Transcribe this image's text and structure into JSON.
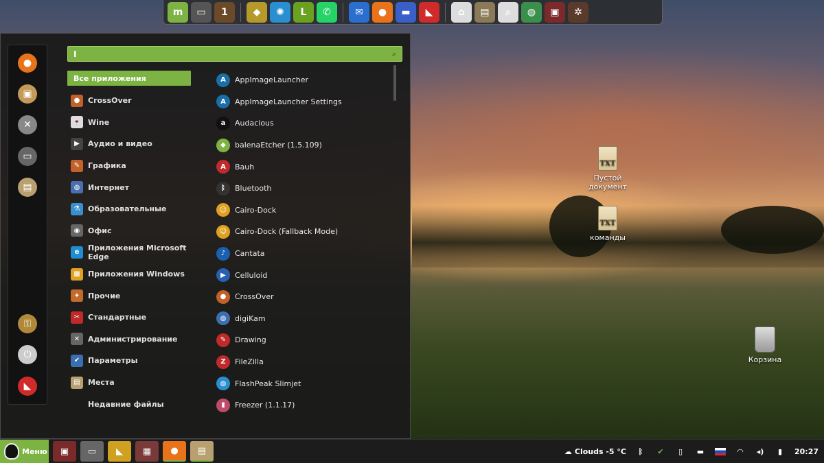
{
  "dock": {
    "items": [
      {
        "name": "linux-mint-icon",
        "glyph": "m",
        "color": "#7cb342"
      },
      {
        "name": "terminal-icon",
        "glyph": "▭",
        "color": "#555"
      },
      {
        "name": "workspace-icon",
        "glyph": "1",
        "color": "#6b4a2a"
      },
      {
        "name": "gpu-viewer-icon",
        "glyph": "◆",
        "color": "#b59a2a"
      },
      {
        "name": "blender-icon",
        "glyph": "✺",
        "color": "#2a8fd0"
      },
      {
        "name": "lime-icon",
        "glyph": "L",
        "color": "#6aa121"
      },
      {
        "name": "whatsapp-icon",
        "glyph": "✆",
        "color": "#25d366"
      },
      {
        "name": "thunderbird-icon",
        "glyph": "✉",
        "color": "#2a6fd0"
      },
      {
        "name": "firefox-icon",
        "glyph": "●",
        "color": "#e8731b"
      },
      {
        "name": "folder-icon",
        "glyph": "▬",
        "color": "#3a5fc8"
      },
      {
        "name": "pdf-reader-icon",
        "glyph": "◣",
        "color": "#d02a2a"
      },
      {
        "name": "home-icon",
        "glyph": "⌂",
        "color": "#ddd"
      },
      {
        "name": "scroll-icon",
        "glyph": "▤",
        "color": "#8a7a55"
      },
      {
        "name": "search-tool-icon",
        "glyph": "⌕",
        "color": "#ddd"
      },
      {
        "name": "globe-icon",
        "glyph": "◍",
        "color": "#3a8f4a"
      },
      {
        "name": "display-icon",
        "glyph": "▣",
        "color": "#7a2a2a"
      },
      {
        "name": "cannon-icon",
        "glyph": "✲",
        "color": "#5a3a2a"
      }
    ]
  },
  "desktop": {
    "icons": [
      {
        "label": "Пустой документ",
        "badge": "TXT"
      },
      {
        "label": "команды",
        "badge": "TXT"
      },
      {
        "label": "Корзина"
      }
    ]
  },
  "menu": {
    "search": {
      "value": "I"
    },
    "side_items": [
      {
        "name": "firefox-side-icon",
        "glyph": "●",
        "color": "#e8731b"
      },
      {
        "name": "package-side-icon",
        "glyph": "▣",
        "color": "#c49a5a"
      },
      {
        "name": "tools-side-icon",
        "glyph": "✕",
        "color": "#888"
      },
      {
        "name": "terminal-side-icon",
        "glyph": "▭",
        "color": "#666"
      },
      {
        "name": "files-side-icon",
        "glyph": "▤",
        "color": "#b8a070"
      },
      {
        "name": "lock-side-icon",
        "glyph": "⚿",
        "color": "#b08a3a"
      },
      {
        "name": "logout-side-icon",
        "glyph": "⏻",
        "color": "#ccc"
      },
      {
        "name": "shutdown-side-icon",
        "glyph": "◣",
        "color": "#d02a2a"
      }
    ],
    "categories": [
      {
        "label": "Все приложения",
        "glyph": ""
      },
      {
        "label": "CrossOver",
        "glyph": "●",
        "color": "#c0612a"
      },
      {
        "label": "Wine",
        "glyph": "🍷",
        "color": "#ddd"
      },
      {
        "label": "Аудио и видео",
        "glyph": "▶",
        "color": "#444"
      },
      {
        "label": "Графика",
        "glyph": "✎",
        "color": "#c4602a"
      },
      {
        "label": "Интернет",
        "glyph": "◍",
        "color": "#4a6fb0"
      },
      {
        "label": "Образовательные",
        "glyph": "⚗",
        "color": "#3a8fd0"
      },
      {
        "label": "Офис",
        "glyph": "◉",
        "color": "#666"
      },
      {
        "label": "Приложения Microsoft Edge",
        "glyph": "e",
        "color": "#1e8ed0"
      },
      {
        "label": "Приложения Windows",
        "glyph": "▦",
        "color": "#e0a020"
      },
      {
        "label": "Прочие",
        "glyph": "✦",
        "color": "#c46a2a"
      },
      {
        "label": "Стандартные",
        "glyph": "✂",
        "color": "#c02a2a"
      },
      {
        "label": "Администрирование",
        "glyph": "✕",
        "color": "#666"
      },
      {
        "label": "Параметры",
        "glyph": "✔",
        "color": "#3a6fb0"
      },
      {
        "label": "Места",
        "glyph": "▤",
        "color": "#b8a070"
      },
      {
        "label": "Недавние файлы",
        "glyph": ""
      }
    ],
    "apps": [
      {
        "label": "AppImageLauncher",
        "glyph": "A",
        "color": "#1a6fa8"
      },
      {
        "label": "AppImageLauncher Settings",
        "glyph": "A",
        "color": "#1a6fa8"
      },
      {
        "label": "Audacious",
        "glyph": "a",
        "color": "#111"
      },
      {
        "label": "balenaEtcher (1.5.109)",
        "glyph": "◆",
        "color": "#7cb342"
      },
      {
        "label": "Bauh",
        "glyph": "A",
        "color": "#c02a2a"
      },
      {
        "label": "Bluetooth",
        "glyph": "ᛒ",
        "color": "#333"
      },
      {
        "label": "Cairo-Dock",
        "glyph": "☺",
        "color": "#e0a020"
      },
      {
        "label": "Cairo-Dock (Fallback Mode)",
        "glyph": "☺",
        "color": "#e0a020"
      },
      {
        "label": "Cantata",
        "glyph": "♪",
        "color": "#1a5fb0"
      },
      {
        "label": "Celluloid",
        "glyph": "▶",
        "color": "#2a5fb0"
      },
      {
        "label": "CrossOver",
        "glyph": "●",
        "color": "#c0612a"
      },
      {
        "label": "digiKam",
        "glyph": "◍",
        "color": "#3a6fb0"
      },
      {
        "label": "Drawing",
        "glyph": "✎",
        "color": "#c02a2a"
      },
      {
        "label": "FileZilla",
        "glyph": "Z",
        "color": "#c02a2a"
      },
      {
        "label": "FlashPeak Slimjet",
        "glyph": "◍",
        "color": "#2a8fd0"
      },
      {
        "label": "Freezer (1.1.17)",
        "glyph": "▮",
        "color": "#c04a6a"
      }
    ]
  },
  "panel": {
    "menu_label": "Меню",
    "tasks": [
      {
        "name": "display-task-icon",
        "glyph": "▣",
        "color": "#7a2a2a",
        "active": false
      },
      {
        "name": "terminal-task-icon",
        "glyph": "▭",
        "color": "#666",
        "active": false
      },
      {
        "name": "colorful-app-task-icon",
        "glyph": "◣",
        "color": "#d0a020",
        "active": false
      },
      {
        "name": "grid-app-task-icon",
        "glyph": "▦",
        "color": "#7a3a3a",
        "active": false
      },
      {
        "name": "firefox-task-icon",
        "glyph": "●",
        "color": "#e8731b",
        "active": true
      },
      {
        "name": "files-task-icon",
        "glyph": "▤",
        "color": "#b8a070",
        "active": true
      }
    ],
    "weather": "Clouds -5 °C",
    "clock": "20:27"
  }
}
